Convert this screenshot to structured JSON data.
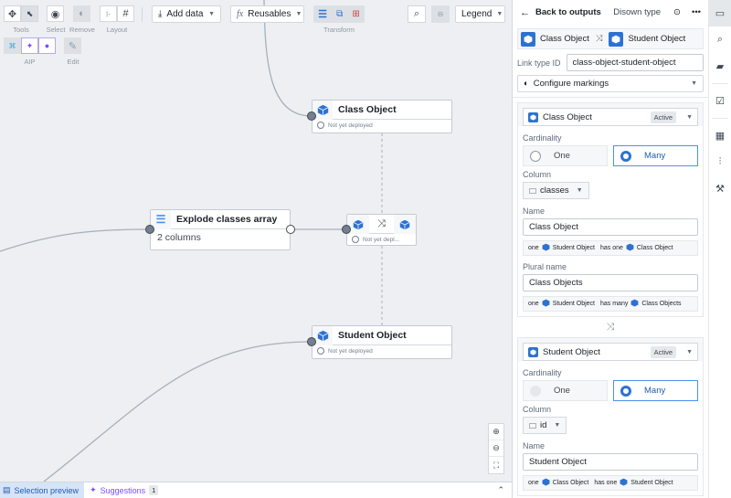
{
  "toolbar": {
    "groups": {
      "tools": "Tools",
      "select": "Select",
      "remove": "Remove",
      "layout": "Layout",
      "aip": "AIP",
      "edit": "Edit",
      "transform": "Transform"
    },
    "add_data": "Add data",
    "reusables": "Reusables",
    "reusables_prefix": "fx",
    "legend": "Legend"
  },
  "graph": {
    "nodes": {
      "class_object": {
        "title": "Class Object",
        "status": "Not yet deployed"
      },
      "explode": {
        "title": "Explode classes array",
        "subtitle": "2 columns"
      },
      "link": {
        "status": "Not yet depl..."
      },
      "student_object": {
        "title": "Student Object",
        "status": "Not yet deployed"
      }
    }
  },
  "bottombar": {
    "selection_preview": "Selection preview",
    "suggestions": "Suggestions",
    "suggestions_count": "1"
  },
  "panel": {
    "back": "Back to outputs",
    "disown": "Disown type",
    "link_source": "Class Object",
    "link_target": "Student Object",
    "link_type_id_label": "Link type ID",
    "link_type_id": "class-object-student-object",
    "configure_markings": "Configure markings",
    "sections": [
      {
        "object": "Class Object",
        "state": "Active",
        "cardinality_label": "Cardinality",
        "one": "One",
        "many": "Many",
        "selected": "Many",
        "column_label": "Column",
        "column": "classes",
        "name_label": "Name",
        "name": "Class Object",
        "name_sentence": {
          "w1": "one",
          "a": "Student Object",
          "w2": "has one",
          "b": "Class Object"
        },
        "plural_label": "Plural name",
        "plural": "Class Objects",
        "plural_sentence": {
          "w1": "one",
          "a": "Student Object",
          "w2": "has many",
          "b": "Class Objects"
        }
      },
      {
        "object": "Student Object",
        "state": "Active",
        "cardinality_label": "Cardinality",
        "one": "One",
        "many": "Many",
        "selected": "Many",
        "column_label": "Column",
        "column": "id",
        "name_label": "Name",
        "name": "Student Object",
        "name_sentence": {
          "w1": "one",
          "a": "Class Object",
          "w2": "has one",
          "b": "Student Object"
        }
      }
    ]
  },
  "colors": {
    "accent": "#2d72d2",
    "aip": "#7c4dff",
    "canvas": "#edeff2"
  }
}
